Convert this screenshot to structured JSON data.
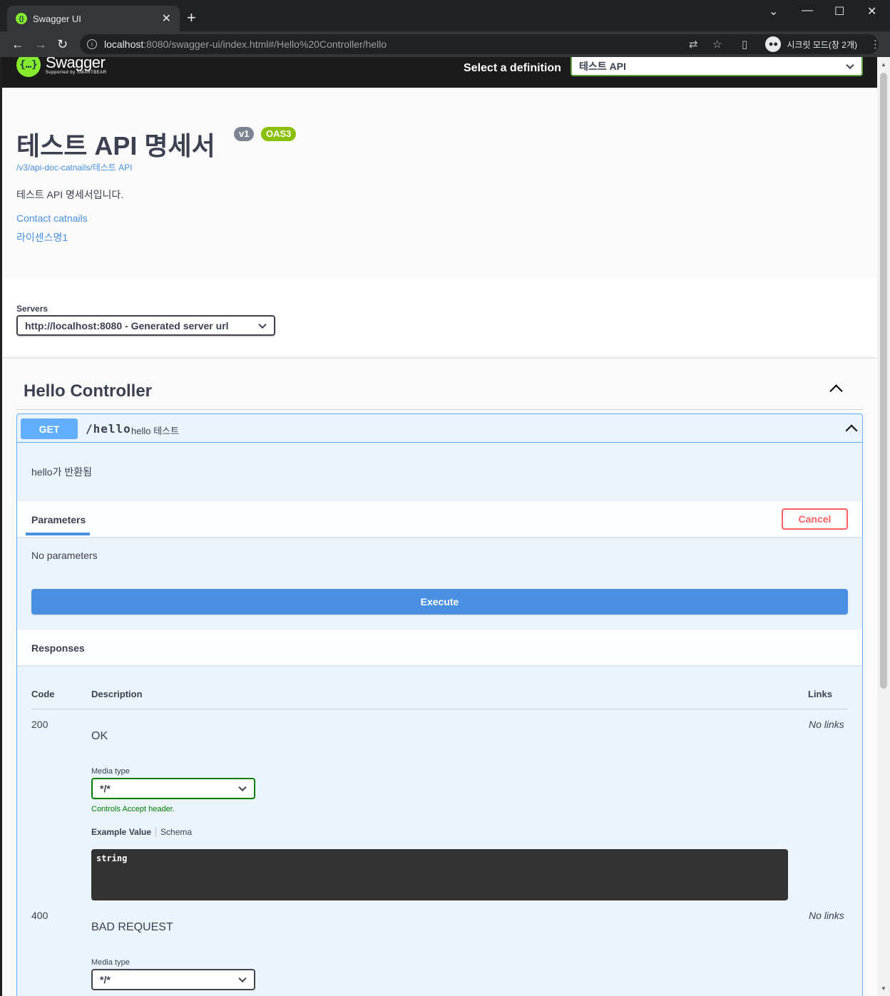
{
  "browser": {
    "tab_title": "Swagger UI",
    "url_host": "localhost",
    "url_path": ":8080/swagger-ui/index.html#/Hello%20Controller/hello",
    "incognito_label": "시크릿 모드(창 2개)"
  },
  "swagger": {
    "logo_text": "Swagger",
    "logo_sub": "Supported by SMARTBEAR",
    "select_definition_label": "Select a definition",
    "definition_value": "테스트 API"
  },
  "info": {
    "title": "테스트 API 명세서",
    "version_badge": "v1",
    "oas_badge": "OAS3",
    "doc_url": "/v3/api-doc-catnails/테스트 API",
    "description": "테스트 API 명세서입니다.",
    "contact_link": "Contact catnails",
    "license_link": "라이센스명1"
  },
  "servers": {
    "label": "Servers",
    "selected": "http://localhost:8080 - Generated server url"
  },
  "controller": {
    "name": "Hello Controller"
  },
  "operation": {
    "method": "GET",
    "path": "/hello",
    "summary": "hello 테스트",
    "description": "hello가 반환됨",
    "parameters_tab": "Parameters",
    "cancel_label": "Cancel",
    "no_params": "No parameters",
    "execute_label": "Execute",
    "responses_title": "Responses",
    "columns": {
      "code": "Code",
      "description": "Description",
      "links": "Links"
    },
    "responses": [
      {
        "code": "200",
        "description": "OK",
        "links": "No links",
        "media_type_label": "Media type",
        "media_type": "*/*",
        "media_note": "Controls Accept header.",
        "example_tab": "Example Value",
        "schema_tab": "Schema",
        "example": "string"
      },
      {
        "code": "400",
        "description": "BAD REQUEST",
        "links": "No links",
        "media_type_label": "Media type",
        "media_type": "*/*"
      }
    ]
  }
}
